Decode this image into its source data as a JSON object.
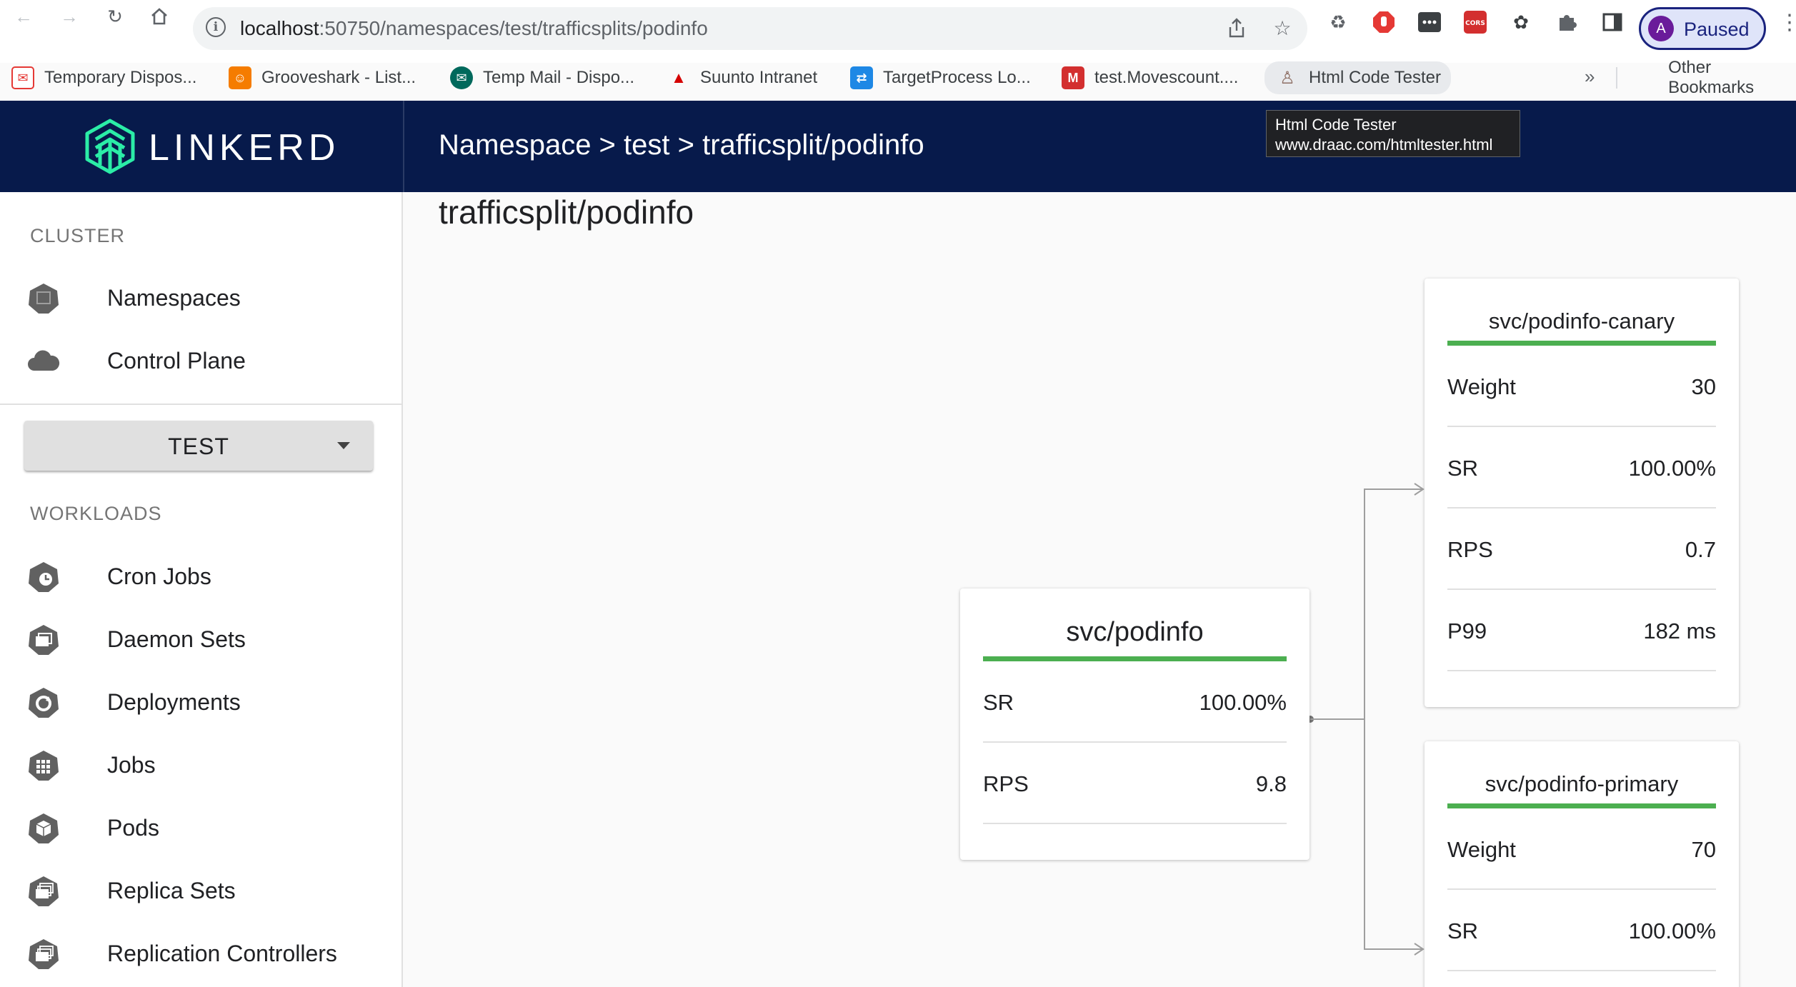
{
  "browser": {
    "url_host": "localhost",
    "url_path": ":50750/namespaces/test/trafficsplits/podinfo",
    "profile_initial": "A",
    "profile_status": "Paused",
    "bookmarks": [
      {
        "label": "Temporary Dispos...",
        "icon": "temp-mail-icon",
        "color": "#e53935"
      },
      {
        "label": "Grooveshark - List...",
        "icon": "grooveshark-icon",
        "color": "#f57c00"
      },
      {
        "label": "Temp Mail - Dispo...",
        "icon": "tempmail-icon",
        "color": "#00695c"
      },
      {
        "label": "Suunto Intranet",
        "icon": "suunto-icon",
        "color": "#d50000"
      },
      {
        "label": "TargetProcess Lo...",
        "icon": "targetprocess-icon",
        "color": "#1e88e5"
      },
      {
        "label": "test.Movescount....",
        "icon": "movescount-icon",
        "color": "#d32f2f"
      },
      {
        "label": "Html Code Tester",
        "icon": "html-tester-icon",
        "color": "#8d6e63"
      }
    ],
    "bookmarks_more": "»",
    "other_bookmarks": "Other Bookmarks",
    "tooltip": {
      "title": "Html Code Tester",
      "url": "www.draac.com/htmltester.html"
    }
  },
  "header": {
    "logo_text": "LINKERD",
    "breadcrumb": "Namespace > test > trafficsplit/podinfo"
  },
  "sidebar": {
    "cluster_label": "CLUSTER",
    "cluster_items": [
      {
        "label": "Namespaces",
        "icon": "namespace-icon"
      },
      {
        "label": "Control Plane",
        "icon": "cloud-icon"
      }
    ],
    "namespace_select": "TEST",
    "workloads_label": "WORKLOADS",
    "workload_items": [
      {
        "label": "Cron Jobs",
        "icon": "cronjob-icon"
      },
      {
        "label": "Daemon Sets",
        "icon": "daemonset-icon"
      },
      {
        "label": "Deployments",
        "icon": "deployment-icon"
      },
      {
        "label": "Jobs",
        "icon": "job-icon"
      },
      {
        "label": "Pods",
        "icon": "pod-icon"
      },
      {
        "label": "Replica Sets",
        "icon": "replicaset-icon"
      },
      {
        "label": "Replication Controllers",
        "icon": "replicationcontroller-icon"
      }
    ]
  },
  "main": {
    "page_title": "trafficsplit/podinfo",
    "source": {
      "name": "svc/podinfo",
      "metrics": [
        {
          "name": "SR",
          "value": "100.00%"
        },
        {
          "name": "RPS",
          "value": "9.8"
        }
      ]
    },
    "leaves": [
      {
        "name": "svc/podinfo-canary",
        "metrics": [
          {
            "name": "Weight",
            "value": "30"
          },
          {
            "name": "SR",
            "value": "100.00%"
          },
          {
            "name": "RPS",
            "value": "0.7"
          },
          {
            "name": "P99",
            "value": "182 ms"
          }
        ]
      },
      {
        "name": "svc/podinfo-primary",
        "metrics": [
          {
            "name": "Weight",
            "value": "70"
          },
          {
            "name": "SR",
            "value": "100.00%"
          }
        ]
      }
    ],
    "success_color": "#4caf50"
  },
  "colors": {
    "header_bg": "#071a4b",
    "logo_accent": "#2beda7"
  }
}
